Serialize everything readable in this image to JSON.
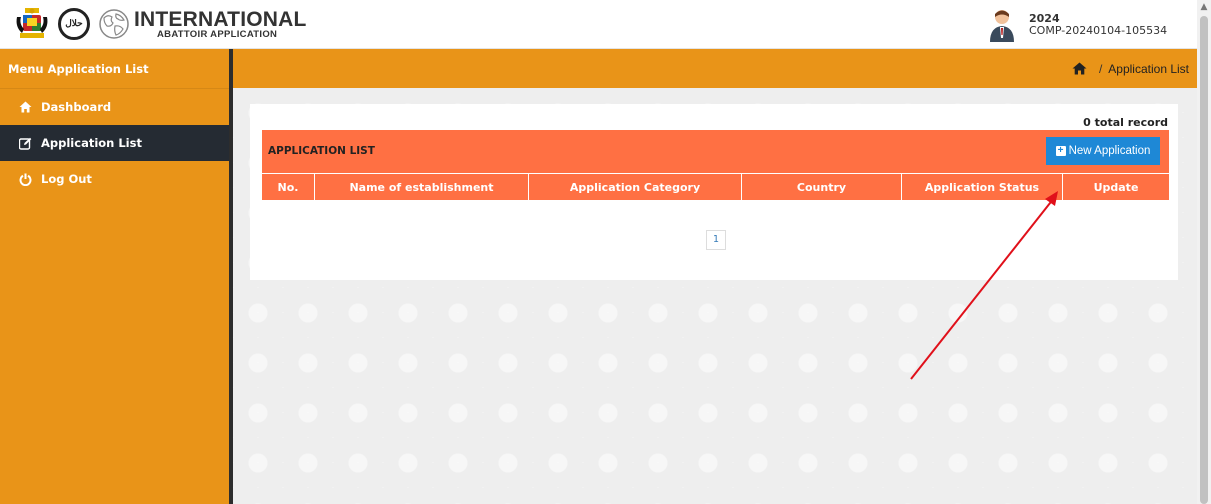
{
  "brand": {
    "title": "INTERNATIONAL",
    "subtitle": "ABATTOIR APPLICATION",
    "halal_label": "حلال"
  },
  "user": {
    "year": "2024",
    "id": "COMP-20240104-105534"
  },
  "sidebar": {
    "title": "Menu Application List",
    "items": [
      {
        "label": "Dashboard",
        "icon": "home-icon"
      },
      {
        "label": "Application List",
        "icon": "edit-icon"
      },
      {
        "label": "Log Out",
        "icon": "power-icon"
      }
    ]
  },
  "breadcrumb": {
    "separator": "/",
    "current": "Application List"
  },
  "panel": {
    "total": "0 total record",
    "list_title": "APPLICATION LIST",
    "new_button": "New Application",
    "columns": [
      "No.",
      "Name of establishment",
      "Application Category",
      "Country",
      "Application Status",
      "Update"
    ],
    "page": "1"
  },
  "colors": {
    "sidebar": "#e99418",
    "table_header": "#ff7043",
    "button": "#1e88d6",
    "active_menu": "#252b33"
  }
}
